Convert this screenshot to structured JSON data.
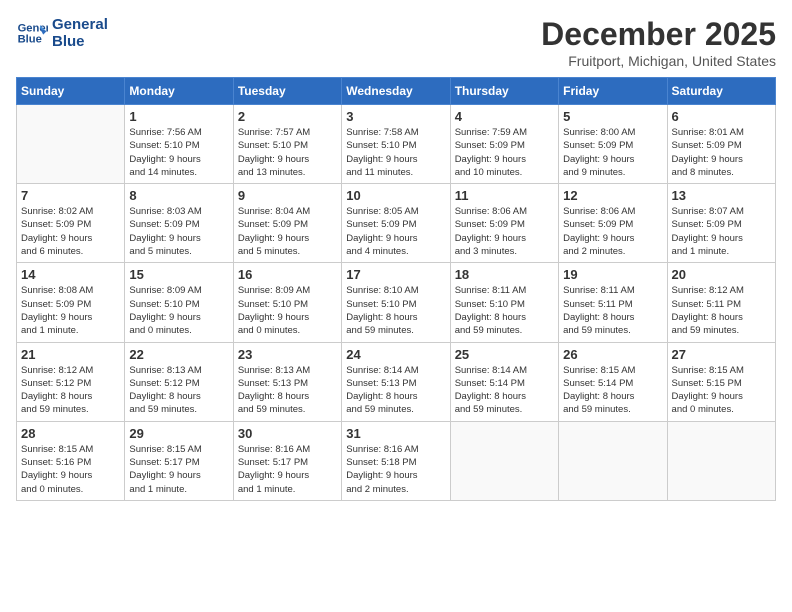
{
  "header": {
    "logo_line1": "General",
    "logo_line2": "Blue",
    "month_title": "December 2025",
    "location": "Fruitport, Michigan, United States"
  },
  "days_of_week": [
    "Sunday",
    "Monday",
    "Tuesday",
    "Wednesday",
    "Thursday",
    "Friday",
    "Saturday"
  ],
  "weeks": [
    [
      {
        "day": "",
        "info": ""
      },
      {
        "day": "1",
        "info": "Sunrise: 7:56 AM\nSunset: 5:10 PM\nDaylight: 9 hours\nand 14 minutes."
      },
      {
        "day": "2",
        "info": "Sunrise: 7:57 AM\nSunset: 5:10 PM\nDaylight: 9 hours\nand 13 minutes."
      },
      {
        "day": "3",
        "info": "Sunrise: 7:58 AM\nSunset: 5:10 PM\nDaylight: 9 hours\nand 11 minutes."
      },
      {
        "day": "4",
        "info": "Sunrise: 7:59 AM\nSunset: 5:09 PM\nDaylight: 9 hours\nand 10 minutes."
      },
      {
        "day": "5",
        "info": "Sunrise: 8:00 AM\nSunset: 5:09 PM\nDaylight: 9 hours\nand 9 minutes."
      },
      {
        "day": "6",
        "info": "Sunrise: 8:01 AM\nSunset: 5:09 PM\nDaylight: 9 hours\nand 8 minutes."
      }
    ],
    [
      {
        "day": "7",
        "info": "Sunrise: 8:02 AM\nSunset: 5:09 PM\nDaylight: 9 hours\nand 6 minutes."
      },
      {
        "day": "8",
        "info": "Sunrise: 8:03 AM\nSunset: 5:09 PM\nDaylight: 9 hours\nand 5 minutes."
      },
      {
        "day": "9",
        "info": "Sunrise: 8:04 AM\nSunset: 5:09 PM\nDaylight: 9 hours\nand 5 minutes."
      },
      {
        "day": "10",
        "info": "Sunrise: 8:05 AM\nSunset: 5:09 PM\nDaylight: 9 hours\nand 4 minutes."
      },
      {
        "day": "11",
        "info": "Sunrise: 8:06 AM\nSunset: 5:09 PM\nDaylight: 9 hours\nand 3 minutes."
      },
      {
        "day": "12",
        "info": "Sunrise: 8:06 AM\nSunset: 5:09 PM\nDaylight: 9 hours\nand 2 minutes."
      },
      {
        "day": "13",
        "info": "Sunrise: 8:07 AM\nSunset: 5:09 PM\nDaylight: 9 hours\nand 1 minute."
      }
    ],
    [
      {
        "day": "14",
        "info": "Sunrise: 8:08 AM\nSunset: 5:09 PM\nDaylight: 9 hours\nand 1 minute."
      },
      {
        "day": "15",
        "info": "Sunrise: 8:09 AM\nSunset: 5:10 PM\nDaylight: 9 hours\nand 0 minutes."
      },
      {
        "day": "16",
        "info": "Sunrise: 8:09 AM\nSunset: 5:10 PM\nDaylight: 9 hours\nand 0 minutes."
      },
      {
        "day": "17",
        "info": "Sunrise: 8:10 AM\nSunset: 5:10 PM\nDaylight: 8 hours\nand 59 minutes."
      },
      {
        "day": "18",
        "info": "Sunrise: 8:11 AM\nSunset: 5:10 PM\nDaylight: 8 hours\nand 59 minutes."
      },
      {
        "day": "19",
        "info": "Sunrise: 8:11 AM\nSunset: 5:11 PM\nDaylight: 8 hours\nand 59 minutes."
      },
      {
        "day": "20",
        "info": "Sunrise: 8:12 AM\nSunset: 5:11 PM\nDaylight: 8 hours\nand 59 minutes."
      }
    ],
    [
      {
        "day": "21",
        "info": "Sunrise: 8:12 AM\nSunset: 5:12 PM\nDaylight: 8 hours\nand 59 minutes."
      },
      {
        "day": "22",
        "info": "Sunrise: 8:13 AM\nSunset: 5:12 PM\nDaylight: 8 hours\nand 59 minutes."
      },
      {
        "day": "23",
        "info": "Sunrise: 8:13 AM\nSunset: 5:13 PM\nDaylight: 8 hours\nand 59 minutes."
      },
      {
        "day": "24",
        "info": "Sunrise: 8:14 AM\nSunset: 5:13 PM\nDaylight: 8 hours\nand 59 minutes."
      },
      {
        "day": "25",
        "info": "Sunrise: 8:14 AM\nSunset: 5:14 PM\nDaylight: 8 hours\nand 59 minutes."
      },
      {
        "day": "26",
        "info": "Sunrise: 8:15 AM\nSunset: 5:14 PM\nDaylight: 8 hours\nand 59 minutes."
      },
      {
        "day": "27",
        "info": "Sunrise: 8:15 AM\nSunset: 5:15 PM\nDaylight: 9 hours\nand 0 minutes."
      }
    ],
    [
      {
        "day": "28",
        "info": "Sunrise: 8:15 AM\nSunset: 5:16 PM\nDaylight: 9 hours\nand 0 minutes."
      },
      {
        "day": "29",
        "info": "Sunrise: 8:15 AM\nSunset: 5:17 PM\nDaylight: 9 hours\nand 1 minute."
      },
      {
        "day": "30",
        "info": "Sunrise: 8:16 AM\nSunset: 5:17 PM\nDaylight: 9 hours\nand 1 minute."
      },
      {
        "day": "31",
        "info": "Sunrise: 8:16 AM\nSunset: 5:18 PM\nDaylight: 9 hours\nand 2 minutes."
      },
      {
        "day": "",
        "info": ""
      },
      {
        "day": "",
        "info": ""
      },
      {
        "day": "",
        "info": ""
      }
    ]
  ]
}
